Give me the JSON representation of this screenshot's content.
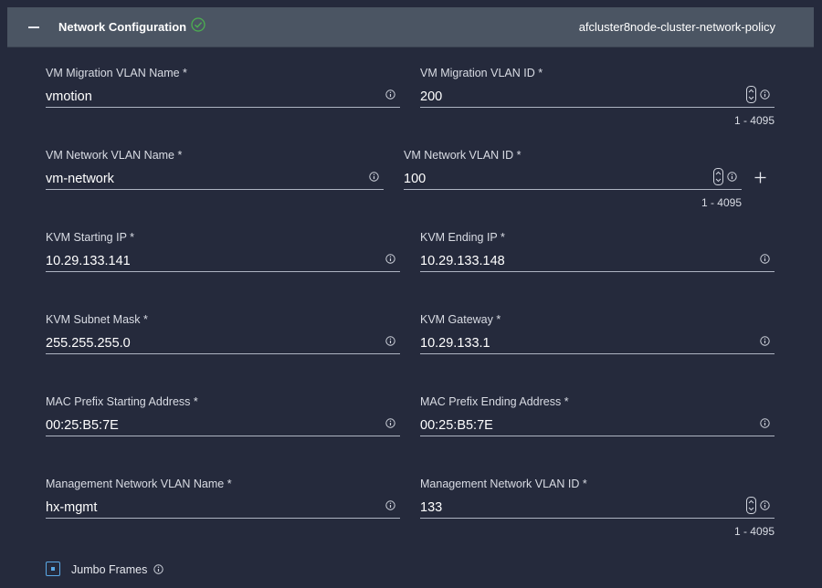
{
  "header": {
    "title": "Network Configuration",
    "policy_name": "afcluster8node-cluster-network-policy",
    "status_icon": "check-circle-icon",
    "status_color": "#4caf50"
  },
  "fields": {
    "vm_migration_vlan_name": {
      "label": "VM Migration VLAN Name *",
      "value": "vmotion"
    },
    "vm_migration_vlan_id": {
      "label": "VM Migration VLAN ID *",
      "value": "200",
      "range": "1 - 4095"
    },
    "vm_network_vlan_name": {
      "label": "VM Network VLAN Name *",
      "value": "vm-network"
    },
    "vm_network_vlan_id": {
      "label": "VM Network VLAN ID *",
      "value": "100",
      "range": "1 - 4095"
    },
    "kvm_starting_ip": {
      "label": "KVM Starting IP *",
      "value": "10.29.133.141"
    },
    "kvm_ending_ip": {
      "label": "KVM Ending IP *",
      "value": "10.29.133.148"
    },
    "kvm_subnet_mask": {
      "label": "KVM Subnet Mask *",
      "value": "255.255.255.0"
    },
    "kvm_gateway": {
      "label": "KVM Gateway *",
      "value": "10.29.133.1"
    },
    "mac_prefix_start": {
      "label": "MAC Prefix Starting Address *",
      "value": "00:25:B5:7E"
    },
    "mac_prefix_end": {
      "label": "MAC Prefix Ending Address *",
      "value": "00:25:B5:7E"
    },
    "mgmt_vlan_name": {
      "label": "Management Network VLAN Name *",
      "value": "hx-mgmt"
    },
    "mgmt_vlan_id": {
      "label": "Management Network VLAN ID *",
      "value": "133",
      "range": "1 - 4095"
    }
  },
  "jumbo_frames": {
    "label": "Jumbo Frames",
    "checked": true
  },
  "colors": {
    "accent": "#5aa9e6",
    "header_bg": "#4b5563",
    "page_bg": "#252a3c"
  }
}
